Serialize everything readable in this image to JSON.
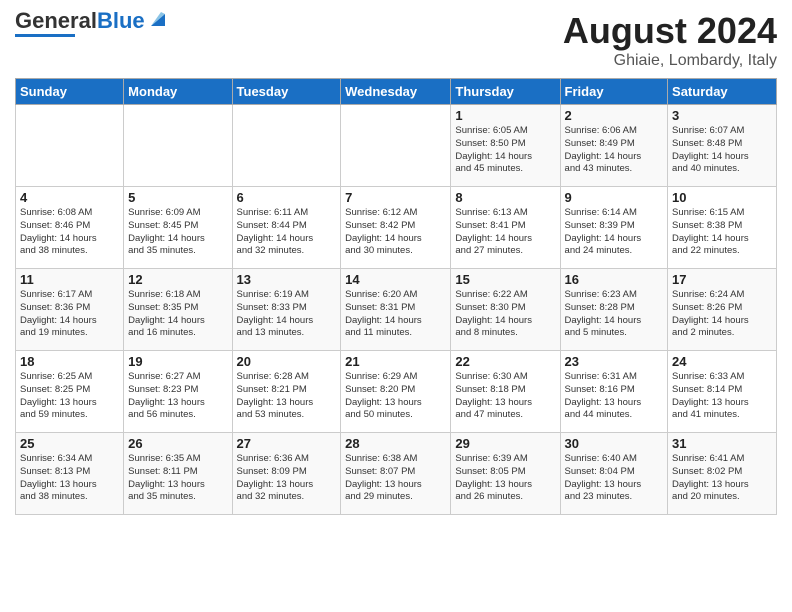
{
  "header": {
    "logo_general": "General",
    "logo_blue": "Blue",
    "month_year": "August 2024",
    "location": "Ghiaie, Lombardy, Italy"
  },
  "days_of_week": [
    "Sunday",
    "Monday",
    "Tuesday",
    "Wednesday",
    "Thursday",
    "Friday",
    "Saturday"
  ],
  "weeks": [
    [
      {
        "day": "",
        "info": ""
      },
      {
        "day": "",
        "info": ""
      },
      {
        "day": "",
        "info": ""
      },
      {
        "day": "",
        "info": ""
      },
      {
        "day": "1",
        "info": "Sunrise: 6:05 AM\nSunset: 8:50 PM\nDaylight: 14 hours\nand 45 minutes."
      },
      {
        "day": "2",
        "info": "Sunrise: 6:06 AM\nSunset: 8:49 PM\nDaylight: 14 hours\nand 43 minutes."
      },
      {
        "day": "3",
        "info": "Sunrise: 6:07 AM\nSunset: 8:48 PM\nDaylight: 14 hours\nand 40 minutes."
      }
    ],
    [
      {
        "day": "4",
        "info": "Sunrise: 6:08 AM\nSunset: 8:46 PM\nDaylight: 14 hours\nand 38 minutes."
      },
      {
        "day": "5",
        "info": "Sunrise: 6:09 AM\nSunset: 8:45 PM\nDaylight: 14 hours\nand 35 minutes."
      },
      {
        "day": "6",
        "info": "Sunrise: 6:11 AM\nSunset: 8:44 PM\nDaylight: 14 hours\nand 32 minutes."
      },
      {
        "day": "7",
        "info": "Sunrise: 6:12 AM\nSunset: 8:42 PM\nDaylight: 14 hours\nand 30 minutes."
      },
      {
        "day": "8",
        "info": "Sunrise: 6:13 AM\nSunset: 8:41 PM\nDaylight: 14 hours\nand 27 minutes."
      },
      {
        "day": "9",
        "info": "Sunrise: 6:14 AM\nSunset: 8:39 PM\nDaylight: 14 hours\nand 24 minutes."
      },
      {
        "day": "10",
        "info": "Sunrise: 6:15 AM\nSunset: 8:38 PM\nDaylight: 14 hours\nand 22 minutes."
      }
    ],
    [
      {
        "day": "11",
        "info": "Sunrise: 6:17 AM\nSunset: 8:36 PM\nDaylight: 14 hours\nand 19 minutes."
      },
      {
        "day": "12",
        "info": "Sunrise: 6:18 AM\nSunset: 8:35 PM\nDaylight: 14 hours\nand 16 minutes."
      },
      {
        "day": "13",
        "info": "Sunrise: 6:19 AM\nSunset: 8:33 PM\nDaylight: 14 hours\nand 13 minutes."
      },
      {
        "day": "14",
        "info": "Sunrise: 6:20 AM\nSunset: 8:31 PM\nDaylight: 14 hours\nand 11 minutes."
      },
      {
        "day": "15",
        "info": "Sunrise: 6:22 AM\nSunset: 8:30 PM\nDaylight: 14 hours\nand 8 minutes."
      },
      {
        "day": "16",
        "info": "Sunrise: 6:23 AM\nSunset: 8:28 PM\nDaylight: 14 hours\nand 5 minutes."
      },
      {
        "day": "17",
        "info": "Sunrise: 6:24 AM\nSunset: 8:26 PM\nDaylight: 14 hours\nand 2 minutes."
      }
    ],
    [
      {
        "day": "18",
        "info": "Sunrise: 6:25 AM\nSunset: 8:25 PM\nDaylight: 13 hours\nand 59 minutes."
      },
      {
        "day": "19",
        "info": "Sunrise: 6:27 AM\nSunset: 8:23 PM\nDaylight: 13 hours\nand 56 minutes."
      },
      {
        "day": "20",
        "info": "Sunrise: 6:28 AM\nSunset: 8:21 PM\nDaylight: 13 hours\nand 53 minutes."
      },
      {
        "day": "21",
        "info": "Sunrise: 6:29 AM\nSunset: 8:20 PM\nDaylight: 13 hours\nand 50 minutes."
      },
      {
        "day": "22",
        "info": "Sunrise: 6:30 AM\nSunset: 8:18 PM\nDaylight: 13 hours\nand 47 minutes."
      },
      {
        "day": "23",
        "info": "Sunrise: 6:31 AM\nSunset: 8:16 PM\nDaylight: 13 hours\nand 44 minutes."
      },
      {
        "day": "24",
        "info": "Sunrise: 6:33 AM\nSunset: 8:14 PM\nDaylight: 13 hours\nand 41 minutes."
      }
    ],
    [
      {
        "day": "25",
        "info": "Sunrise: 6:34 AM\nSunset: 8:13 PM\nDaylight: 13 hours\nand 38 minutes."
      },
      {
        "day": "26",
        "info": "Sunrise: 6:35 AM\nSunset: 8:11 PM\nDaylight: 13 hours\nand 35 minutes."
      },
      {
        "day": "27",
        "info": "Sunrise: 6:36 AM\nSunset: 8:09 PM\nDaylight: 13 hours\nand 32 minutes."
      },
      {
        "day": "28",
        "info": "Sunrise: 6:38 AM\nSunset: 8:07 PM\nDaylight: 13 hours\nand 29 minutes."
      },
      {
        "day": "29",
        "info": "Sunrise: 6:39 AM\nSunset: 8:05 PM\nDaylight: 13 hours\nand 26 minutes."
      },
      {
        "day": "30",
        "info": "Sunrise: 6:40 AM\nSunset: 8:04 PM\nDaylight: 13 hours\nand 23 minutes."
      },
      {
        "day": "31",
        "info": "Sunrise: 6:41 AM\nSunset: 8:02 PM\nDaylight: 13 hours\nand 20 minutes."
      }
    ]
  ]
}
